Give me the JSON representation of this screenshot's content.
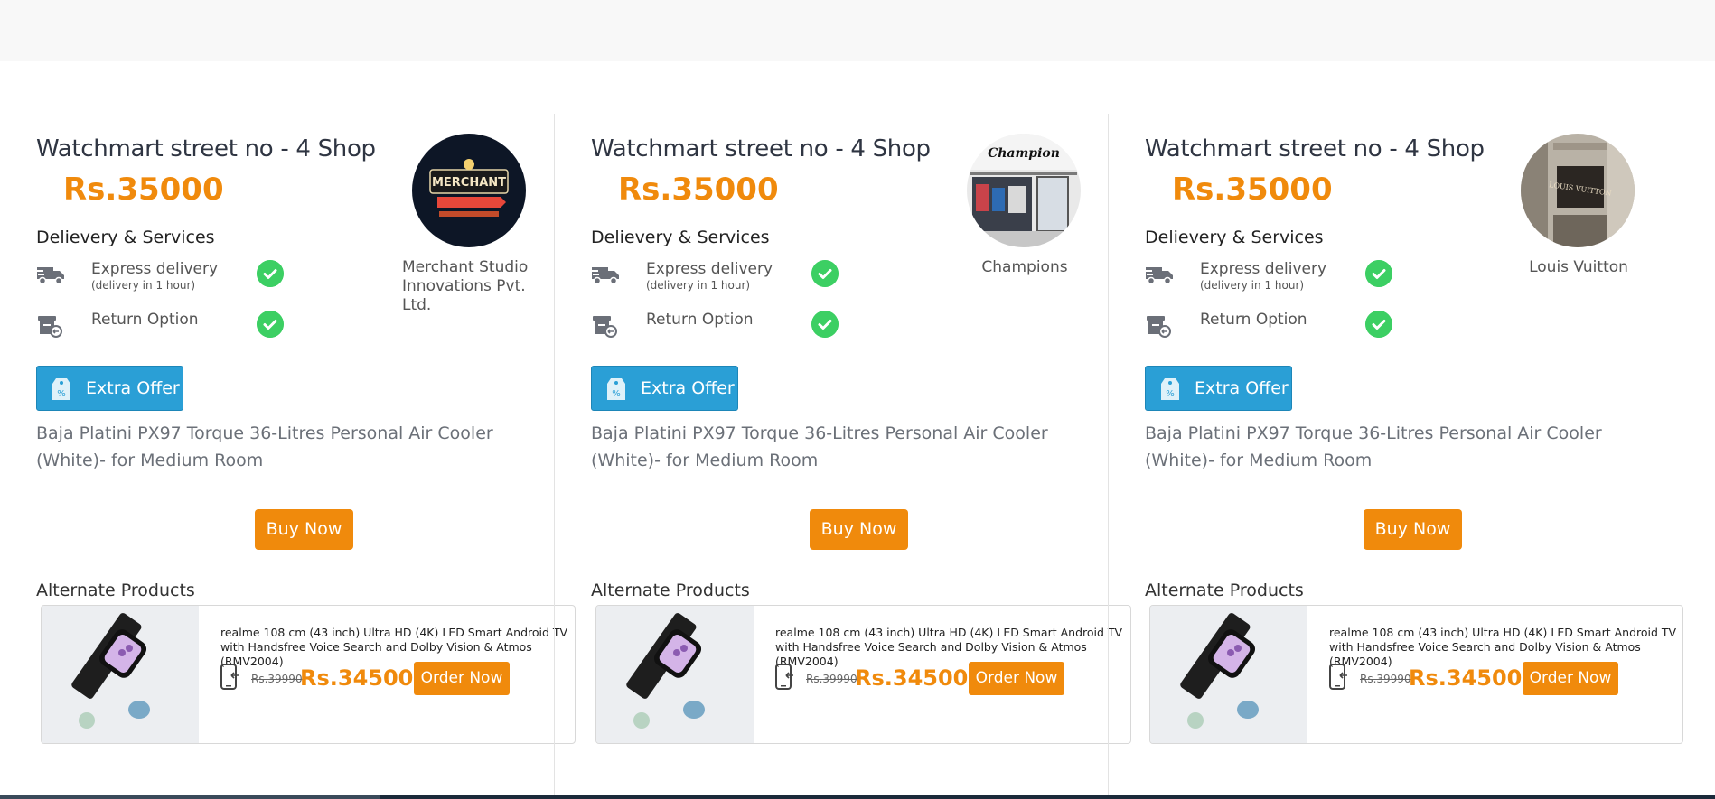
{
  "colors": {
    "accent_orange": "#f08a0c",
    "offer_blue": "#2a9fd6",
    "check_green": "#3ccf63"
  },
  "shops": [
    {
      "title": "Watchmart street no - 4 Shop",
      "price": "Rs.35000",
      "services_title": "Delievery & Services",
      "services": [
        {
          "label": "Express delivery",
          "sub": "(delivery in 1 hour)",
          "icon": "truck-icon"
        },
        {
          "label": "Return Option",
          "sub": "",
          "icon": "return-box-icon"
        }
      ],
      "store_name": "Merchant Studio Innovations Pvt. Ltd.",
      "store_logo": "merchant-neon-sign",
      "offer_label": "Extra Offer",
      "description": "Baja Platini PX97 Torque 36-Litres Personal Air Cooler (White)- for Medium Room",
      "buy_label": "Buy Now",
      "alternate_title": "Alternate Products",
      "alternate": {
        "name": "realme 108 cm (43 inch) Ultra HD (4K) LED Smart Android TV with Handsfree Voice Search and Dolby Vision & Atmos (RMV2004)",
        "old_price": "Rs.39990",
        "new_price": "Rs.34500",
        "order_label": "Order Now"
      }
    },
    {
      "title": "Watchmart street no - 4 Shop",
      "price": "Rs.35000",
      "services_title": "Delievery & Services",
      "services": [
        {
          "label": "Express delivery",
          "sub": "(delivery in 1 hour)",
          "icon": "truck-icon"
        },
        {
          "label": "Return Option",
          "sub": "",
          "icon": "return-box-icon"
        }
      ],
      "store_name": "Champions",
      "store_logo": "champion-storefront",
      "offer_label": "Extra Offer",
      "description": "Baja Platini PX97 Torque 36-Litres Personal Air Cooler (White)- for Medium Room",
      "buy_label": "Buy Now",
      "alternate_title": "Alternate Products",
      "alternate": {
        "name": "realme 108 cm (43 inch) Ultra HD (4K) LED Smart Android TV with Handsfree Voice Search and Dolby Vision & Atmos (RMV2004)",
        "old_price": "Rs.39990",
        "new_price": "Rs.34500",
        "order_label": "Order Now"
      }
    },
    {
      "title": "Watchmart street no - 4 Shop",
      "price": "Rs.35000",
      "services_title": "Delievery & Services",
      "services": [
        {
          "label": "Express delivery",
          "sub": "(delivery in 1 hour)",
          "icon": "truck-icon"
        },
        {
          "label": "Return Option",
          "sub": "",
          "icon": "return-box-icon"
        }
      ],
      "store_name": "Louis Vuitton",
      "store_logo": "louis-vuitton-storefront",
      "offer_label": "Extra Offer",
      "description": "Baja Platini PX97 Torque 36-Litres Personal Air Cooler (White)- for Medium Room",
      "buy_label": "Buy Now",
      "alternate_title": "Alternate Products",
      "alternate": {
        "name": "realme 108 cm (43 inch) Ultra HD (4K) LED Smart Android TV with Handsfree Voice Search and Dolby Vision & Atmos (RMV2004)",
        "old_price": "Rs.39990",
        "new_price": "Rs.34500",
        "order_label": "Order Now"
      }
    }
  ]
}
